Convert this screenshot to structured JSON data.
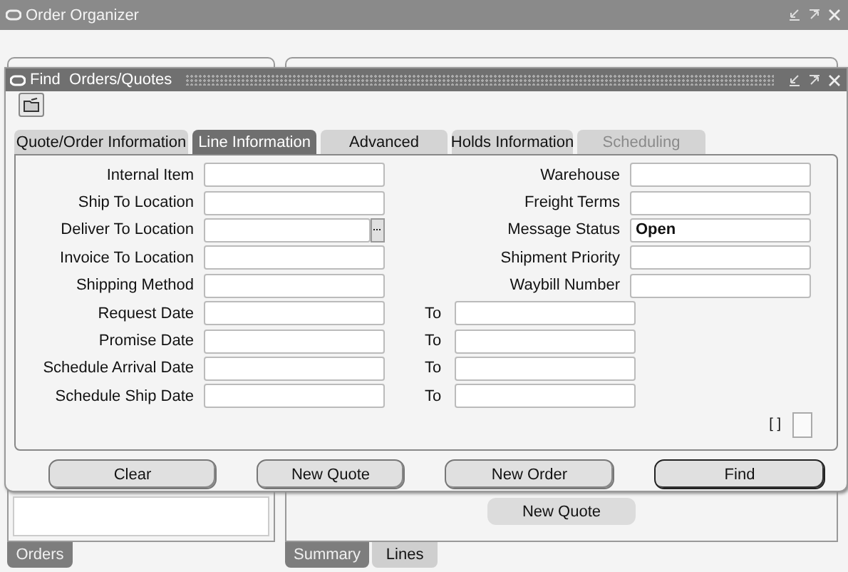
{
  "window": {
    "title": "Order Organizer"
  },
  "background": {
    "left_tabs": [
      {
        "label": "Orders",
        "selected": true
      }
    ],
    "right_tabs": [
      {
        "label": "Summary",
        "selected": true
      },
      {
        "label": "Lines",
        "selected": false
      }
    ],
    "hidden_button": "New Quote"
  },
  "dialog": {
    "title": "Find  Orders/Quotes",
    "tabs": [
      {
        "label": "Quote/Order Information",
        "selected": false,
        "disabled": false
      },
      {
        "label": "Line Information",
        "selected": true,
        "disabled": false
      },
      {
        "label": "Advanced",
        "selected": false,
        "disabled": false
      },
      {
        "label": "Holds Information",
        "selected": false,
        "disabled": false
      },
      {
        "label": "Scheduling",
        "selected": false,
        "disabled": true
      }
    ],
    "rows": [
      {
        "label": "Internal Item",
        "lov": false,
        "right": {
          "kind": "field",
          "label": "Warehouse"
        }
      },
      {
        "label": "Ship To Location",
        "lov": false,
        "right": {
          "kind": "field",
          "label": "Freight Terms"
        }
      },
      {
        "label": "Deliver To Location",
        "lov": true,
        "right": {
          "kind": "field",
          "label": "Message Status",
          "value": "Open"
        }
      },
      {
        "label": "Invoice To Location",
        "lov": false,
        "right": {
          "kind": "field",
          "label": "Shipment Priority"
        }
      },
      {
        "label": "Shipping Method",
        "lov": false,
        "right": {
          "kind": "field",
          "label": "Waybill Number"
        }
      },
      {
        "label": "Request Date",
        "lov": false,
        "right": {
          "kind": "range",
          "label": "To"
        }
      },
      {
        "label": "Promise Date",
        "lov": false,
        "right": {
          "kind": "range",
          "label": "To"
        }
      },
      {
        "label": "Schedule Arrival Date",
        "lov": false,
        "right": {
          "kind": "range",
          "label": "To"
        }
      },
      {
        "label": "Schedule Ship Date",
        "lov": false,
        "right": {
          "kind": "range",
          "label": "To"
        }
      }
    ],
    "flex_label": "[ ]",
    "buttons": [
      {
        "label": "Clear",
        "default": false
      },
      {
        "label": "New Quote",
        "default": false
      },
      {
        "label": "New Order",
        "default": false
      },
      {
        "label": "Find",
        "default": true
      }
    ]
  }
}
